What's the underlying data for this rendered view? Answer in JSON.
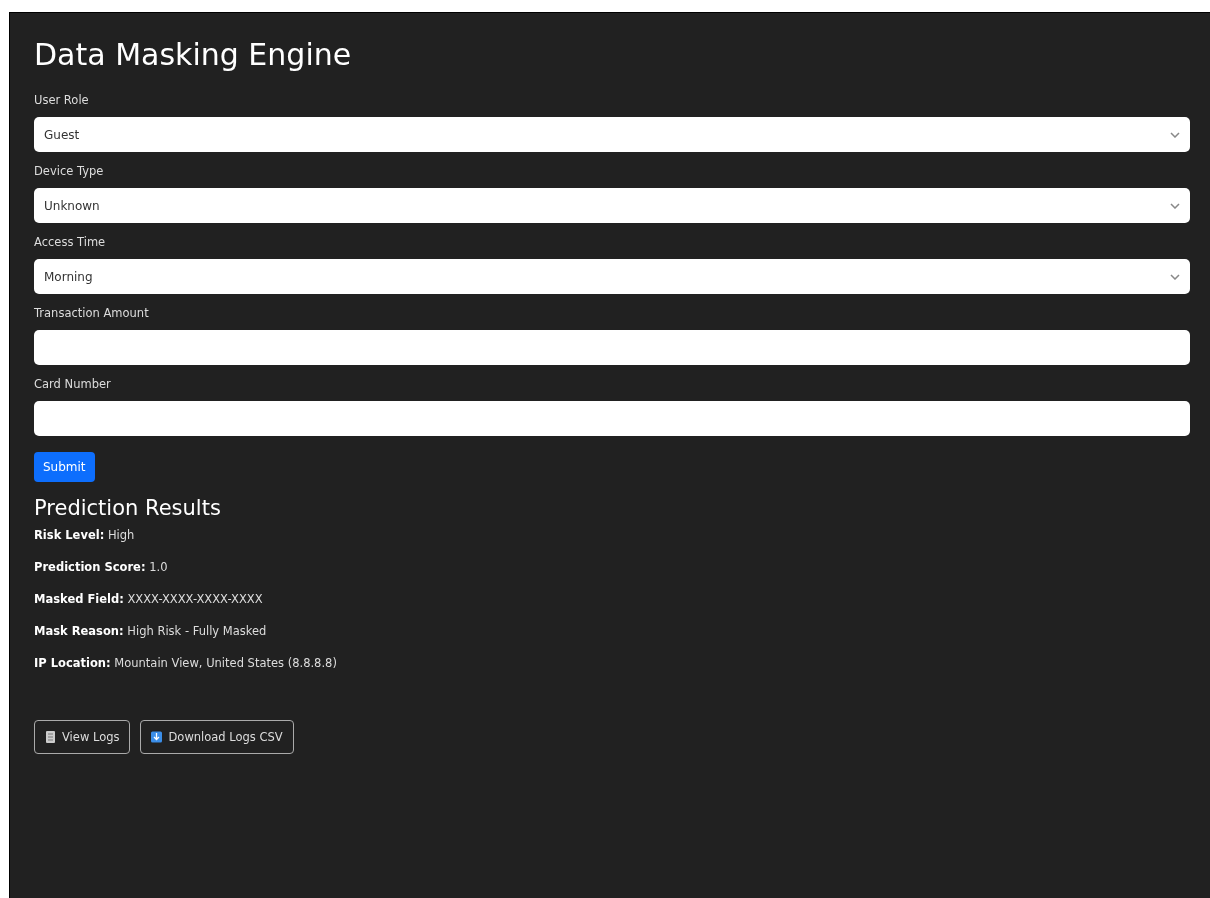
{
  "title": "Data Masking Engine",
  "fields": [
    {
      "kind": "select",
      "label": "User Role",
      "value": "Guest"
    },
    {
      "kind": "select",
      "label": "Device Type",
      "value": "Unknown"
    },
    {
      "kind": "select",
      "label": "Access Time",
      "value": "Morning"
    },
    {
      "kind": "input",
      "label": "Transaction Amount"
    },
    {
      "kind": "input",
      "label": "Card Number"
    }
  ],
  "submit": "Submit",
  "results": {
    "heading": "Prediction Results",
    "items": [
      {
        "label": "Risk Level:",
        "value": "High"
      },
      {
        "label": "Prediction Score:",
        "value": "1.0"
      },
      {
        "label": "Masked Field:",
        "value": "XXXX-XXXX-XXXX-XXXX"
      },
      {
        "label": "Mask Reason:",
        "value": "High Risk - Fully Masked"
      },
      {
        "label": "IP Location:",
        "value": "Mountain View, United States (8.8.8.8)"
      }
    ]
  },
  "actions": [
    {
      "kind": "view",
      "label": "View Logs"
    },
    {
      "kind": "download",
      "label": "Download Logs CSV"
    }
  ]
}
